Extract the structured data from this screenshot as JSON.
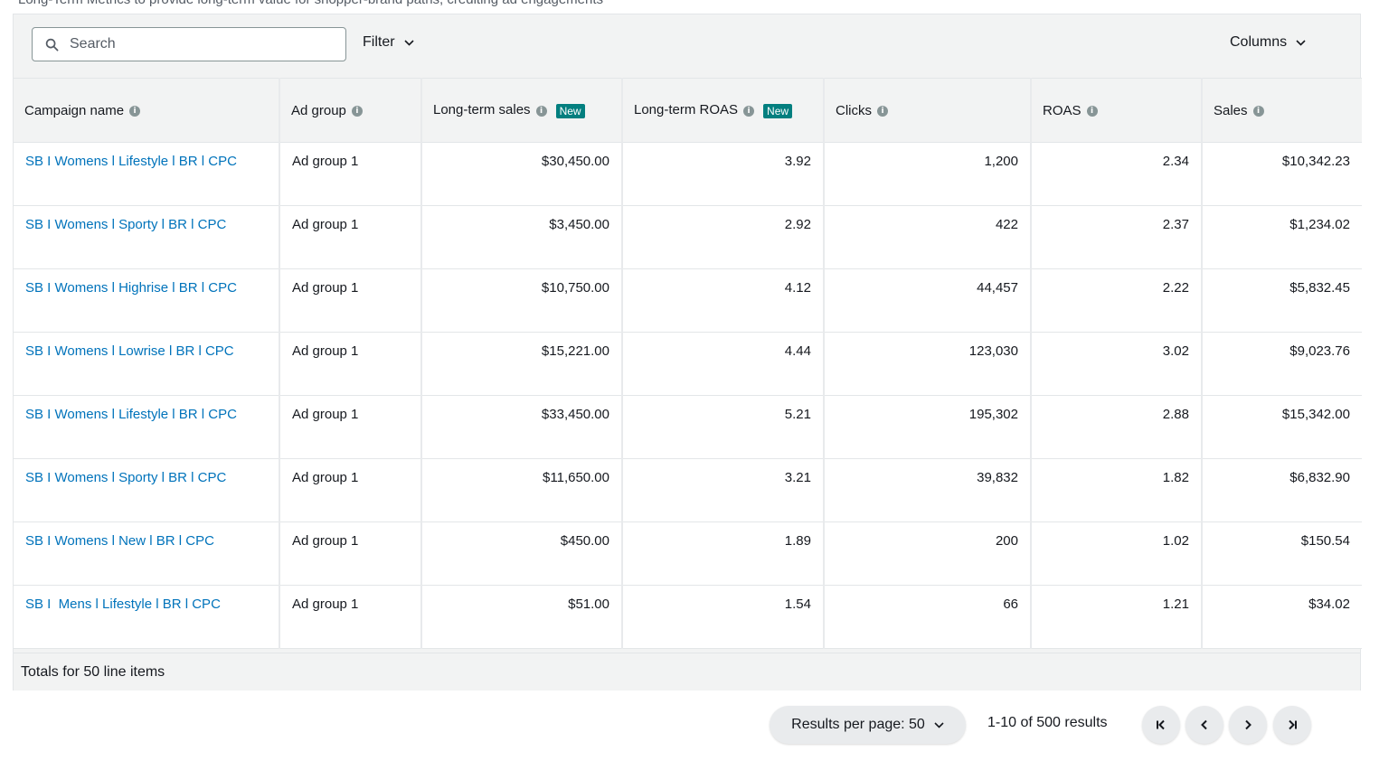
{
  "caption": "Long-Term Metrics to provide long-term value for shopper-brand paths, crediting ad engagements",
  "search": {
    "placeholder": "Search"
  },
  "toolbar": {
    "filter_label": "Filter",
    "columns_label": "Columns"
  },
  "columns": {
    "campaign": "Campaign name",
    "adgroup": "Ad group",
    "lt_sales": "Long-term sales",
    "lt_roas": "Long-term ROAS",
    "clicks": "Clicks",
    "roas": "ROAS",
    "sales": "Sales",
    "new_badge": "New"
  },
  "rows": [
    {
      "campaign": "SB I Womens l Lifestyle l BR l CPC",
      "adgroup": "Ad group 1",
      "lt_sales": "$30,450.00",
      "lt_roas": "3.92",
      "clicks": "1,200",
      "roas": "2.34",
      "sales": "$10,342.23"
    },
    {
      "campaign": "SB I Womens l Sporty l BR l CPC",
      "adgroup": "Ad group 1",
      "lt_sales": "$3,450.00",
      "lt_roas": "2.92",
      "clicks": "422",
      "roas": "2.37",
      "sales": "$1,234.02"
    },
    {
      "campaign": "SB I Womens l Highrise l BR l CPC",
      "adgroup": "Ad group 1",
      "lt_sales": "$10,750.00",
      "lt_roas": "4.12",
      "clicks": "44,457",
      "roas": "2.22",
      "sales": "$5,832.45"
    },
    {
      "campaign": "SB I Womens l Lowrise l BR l CPC",
      "adgroup": "Ad group 1",
      "lt_sales": "$15,221.00",
      "lt_roas": "4.44",
      "clicks": "123,030",
      "roas": "3.02",
      "sales": "$9,023.76"
    },
    {
      "campaign": "SB I Womens l Lifestyle l BR l CPC",
      "adgroup": "Ad group 1",
      "lt_sales": "$33,450.00",
      "lt_roas": "5.21",
      "clicks": "195,302",
      "roas": "2.88",
      "sales": "$15,342.00"
    },
    {
      "campaign": "SB I Womens l Sporty l BR l CPC",
      "adgroup": "Ad group 1",
      "lt_sales": "$11,650.00",
      "lt_roas": "3.21",
      "clicks": "39,832",
      "roas": "1.82",
      "sales": "$6,832.90"
    },
    {
      "campaign": "SB I Womens l New l BR l CPC",
      "adgroup": "Ad group 1",
      "lt_sales": "$450.00",
      "lt_roas": "1.89",
      "clicks": "200",
      "roas": "1.02",
      "sales": "$150.54"
    },
    {
      "campaign": "SB I  Mens l Lifestyle l BR l CPC",
      "adgroup": "Ad group 1",
      "lt_sales": "$51.00",
      "lt_roas": "1.54",
      "clicks": "66",
      "roas": "1.21",
      "sales": "$34.02"
    }
  ],
  "totals_label": "Totals for 50 line items",
  "pagination": {
    "per_page_label": "Results per page: 50",
    "results_label": "1-10 of 500 results"
  },
  "colors": {
    "link": "#0073bb",
    "badge": "#037f7f",
    "header_bg": "#f2f3f3"
  },
  "icons": {
    "search": "search-icon",
    "info": "info-icon",
    "chevron": "chevron-down-icon"
  }
}
